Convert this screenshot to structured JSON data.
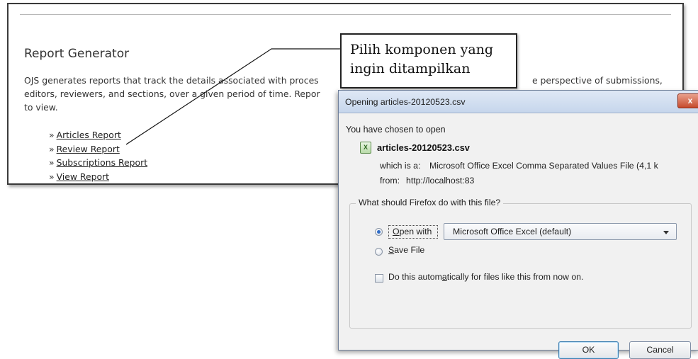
{
  "page": {
    "title": "Report Generator",
    "description_line1": "OJS generates reports that track the details associated with proces",
    "description_line1_tail": "e perspective of submissions,",
    "description_line2": "editors, reviewers, and sections, over a given period of time. Repor",
    "description_line3": "to view.",
    "links": [
      {
        "prefix": "»",
        "label": "Articles Report"
      },
      {
        "prefix": "»",
        "label": "Review Report"
      },
      {
        "prefix": "»",
        "label": "Subscriptions Report"
      },
      {
        "prefix": "»",
        "label": "View Report"
      }
    ]
  },
  "callout": {
    "line1": "Pilih komponen yang",
    "line2": "ingin ditampilkan"
  },
  "dialog": {
    "title": "Opening articles-20120523.csv",
    "close_label": "x",
    "chosen_text": "You have chosen to open",
    "file_icon": "csv-file-icon",
    "file_name": "articles-20120523.csv",
    "which_label": "which is a:",
    "which_value": "Microsoft Office Excel Comma Separated Values File (4,1 k",
    "from_label": "from:",
    "from_value": "http://localhost:83",
    "question": "What should Firefox do with this file?",
    "open_with_label": "Open with",
    "open_with_selected": true,
    "app_select_value": "Microsoft Office Excel (default)",
    "save_file_label": "Save File",
    "auto_label": "Do this automatically for files like this from now on.",
    "auto_checked": false,
    "ok_label": "OK",
    "cancel_label": "Cancel"
  },
  "colors": {
    "titlebar": "#c6d6ec",
    "close_button": "#c64a2d",
    "dialog_body": "#f1f1f1",
    "link_text": "#222222"
  }
}
